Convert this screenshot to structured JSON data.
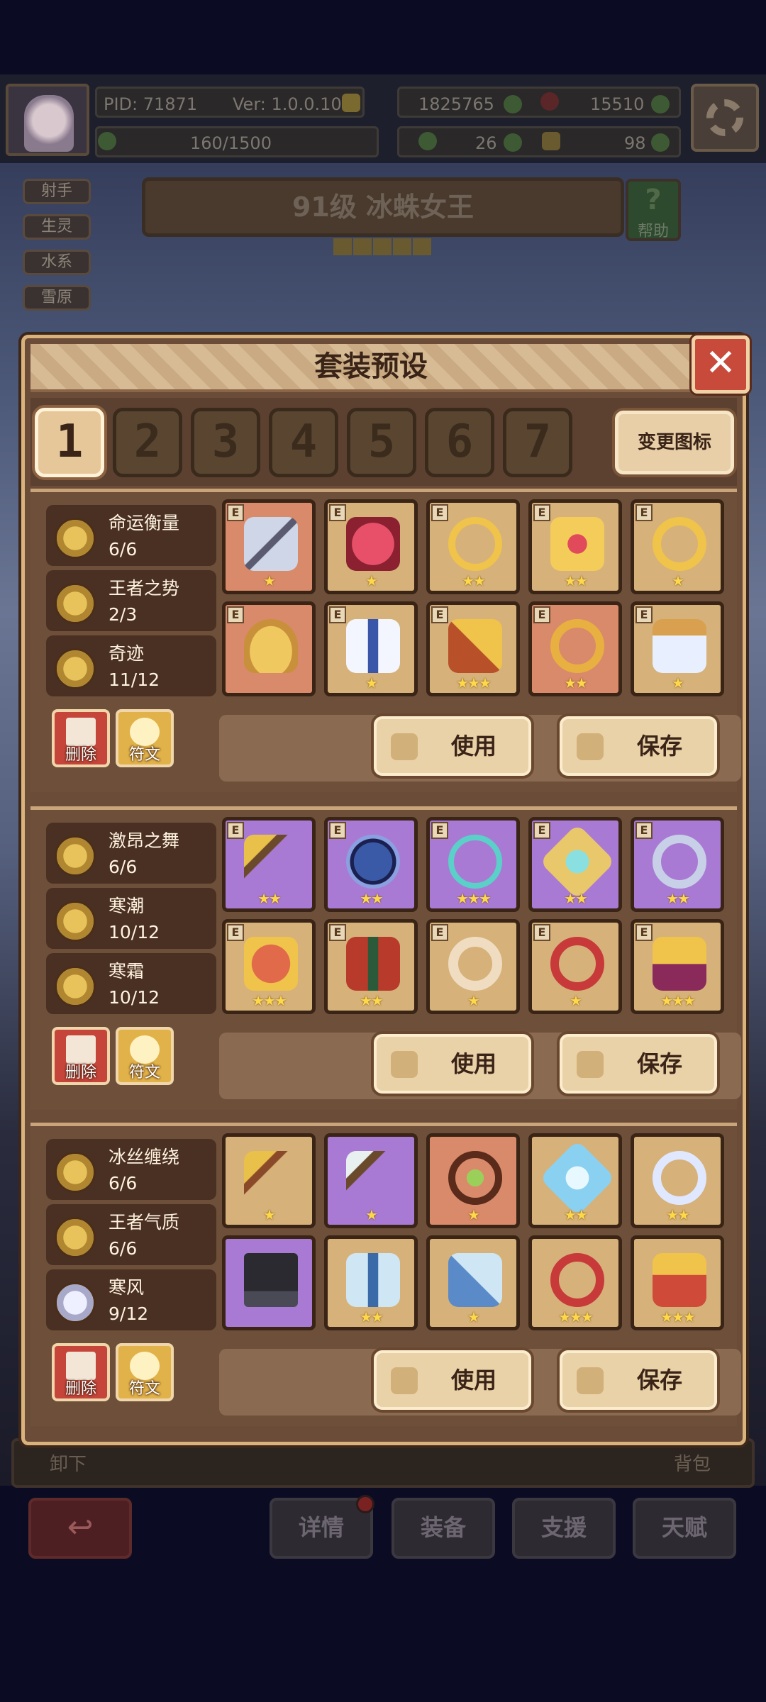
{
  "hud": {
    "pid": "PID: 71871",
    "version": "Ver: 1.0.0.10",
    "gold": "1825765",
    "gems": "15510",
    "energy": "160/1500",
    "clover": "26",
    "tickets": "98"
  },
  "hero": {
    "tags": [
      "射手",
      "生灵",
      "水系",
      "雪原"
    ],
    "title": "91级  冰蛛女王",
    "help_label": "帮助",
    "help_symbol": "?"
  },
  "modal": {
    "title": "套装预设",
    "close_symbol": "✕",
    "tabs": [
      "1",
      "2",
      "3",
      "4",
      "5",
      "6",
      "7"
    ],
    "change_icon_label": "变更图标"
  },
  "presets": [
    {
      "bonuses": [
        {
          "name": "命运衡量",
          "count": "6/6",
          "coin": "gold"
        },
        {
          "name": "王者之势",
          "count": "2/3",
          "coin": "gold"
        },
        {
          "name": "奇迹",
          "count": "11/12",
          "coin": "gold"
        }
      ],
      "delete_label": "删除",
      "rune_label": "符文",
      "use_label": "使用",
      "save_label": "保存"
    },
    {
      "bonuses": [
        {
          "name": "激昂之舞",
          "count": "6/6",
          "coin": "gold"
        },
        {
          "name": "寒潮",
          "count": "10/12",
          "coin": "gold"
        },
        {
          "name": "寒霜",
          "count": "10/12",
          "coin": "gold"
        }
      ],
      "delete_label": "删除",
      "rune_label": "符文",
      "use_label": "使用",
      "save_label": "保存"
    },
    {
      "bonuses": [
        {
          "name": "冰丝缠绕",
          "count": "6/6",
          "coin": "gold"
        },
        {
          "name": "王者气质",
          "count": "6/6",
          "coin": "gold"
        },
        {
          "name": "寒风",
          "count": "9/12",
          "coin": "silver"
        }
      ],
      "delete_label": "删除",
      "rune_label": "符文",
      "use_label": "使用",
      "save_label": "保存"
    }
  ],
  "bottom": {
    "unequip_label": "卸下",
    "bag_label": "背包",
    "nav": [
      "详情",
      "装备",
      "支援",
      "天赋"
    ],
    "back_symbol": "↩"
  },
  "colors": {
    "slot_tan": "#d6b27a",
    "slot_red": "#d98a6a",
    "slot_purple": "#a97ad4",
    "frame": "#6e503a",
    "star": "#ffd84a"
  }
}
